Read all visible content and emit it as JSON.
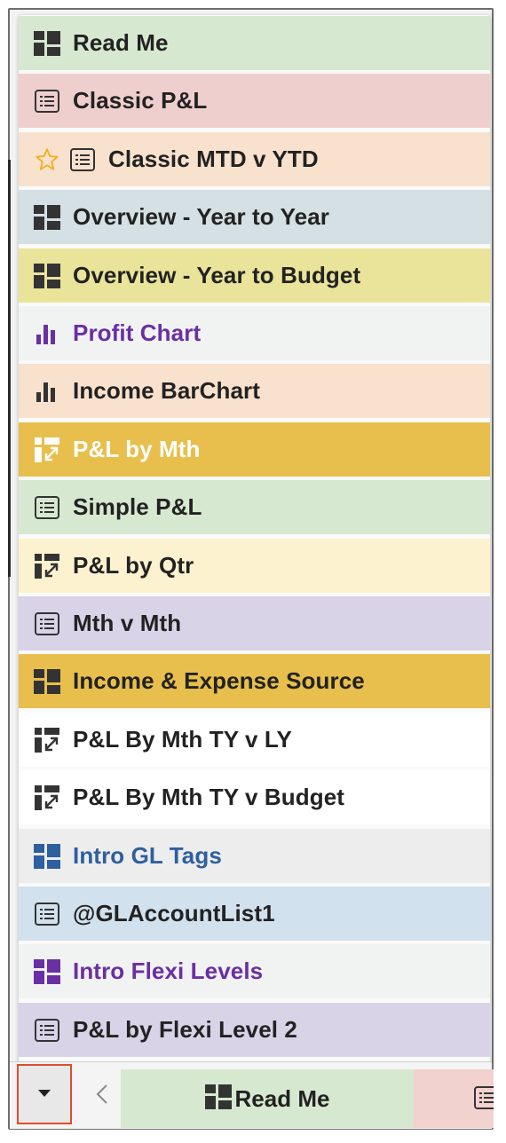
{
  "menu": {
    "items": [
      {
        "label": "Read Me",
        "icon": "dashboard-icon",
        "bg": "#d7e8d0",
        "fg": "#222222",
        "icon_color": "#333333",
        "favorite": false
      },
      {
        "label": "Classic P&L",
        "icon": "report-list-icon",
        "bg": "#efcfcd",
        "fg": "#222222",
        "icon_color": "#333333",
        "favorite": false
      },
      {
        "label": "Classic MTD v YTD",
        "icon": "report-list-icon",
        "bg": "#f8e1cd",
        "fg": "#222222",
        "icon_color": "#333333",
        "favorite": true,
        "favorite_icon": "star-icon"
      },
      {
        "label": "Overview - Year to Year",
        "icon": "dashboard-icon",
        "bg": "#d4e0e3",
        "fg": "#222222",
        "icon_color": "#333333",
        "favorite": false
      },
      {
        "label": "Overview - Year to Budget",
        "icon": "dashboard-icon",
        "bg": "#eae49a",
        "fg": "#222222",
        "icon_color": "#333333",
        "favorite": false
      },
      {
        "label": "Profit Chart",
        "icon": "bar-chart-icon",
        "bg": "#f1f2f2",
        "fg": "#6a2fa3",
        "icon_color": "#6a2fa3",
        "favorite": false
      },
      {
        "label": "Income BarChart",
        "icon": "bar-chart-icon",
        "bg": "#f8e1cd",
        "fg": "#222222",
        "icon_color": "#333333",
        "favorite": false
      },
      {
        "label": "P&L by Mth",
        "icon": "pivot-icon",
        "bg": "#e8bf4c",
        "fg": "#ffffff",
        "icon_color": "#ffffff",
        "favorite": false
      },
      {
        "label": "Simple P&L",
        "icon": "report-list-icon",
        "bg": "#d7e8d0",
        "fg": "#222222",
        "icon_color": "#333333",
        "favorite": false
      },
      {
        "label": "P&L by Qtr",
        "icon": "pivot-icon",
        "bg": "#fdf2cf",
        "fg": "#222222",
        "icon_color": "#333333",
        "favorite": false
      },
      {
        "label": "Mth v Mth",
        "icon": "report-list-icon",
        "bg": "#d9d3e8",
        "fg": "#222222",
        "icon_color": "#333333",
        "favorite": false
      },
      {
        "label": "Income & Expense Source",
        "icon": "dashboard-icon",
        "bg": "#e8bf4c",
        "fg": "#222222",
        "icon_color": "#333333",
        "favorite": false
      },
      {
        "label": "P&L By Mth TY v LY",
        "icon": "pivot-icon",
        "bg": "#ffffff",
        "fg": "#222222",
        "icon_color": "#333333",
        "favorite": false
      },
      {
        "label": "P&L By Mth TY v Budget",
        "icon": "pivot-icon",
        "bg": "#ffffff",
        "fg": "#222222",
        "icon_color": "#333333",
        "favorite": false
      },
      {
        "label": "Intro GL Tags",
        "icon": "dashboard-icon",
        "bg": "#ededed",
        "fg": "#2e5f9e",
        "icon_color": "#2e5f9e",
        "favorite": false
      },
      {
        "label": "@GLAccountList1",
        "icon": "report-list-icon",
        "bg": "#d2e1ee",
        "fg": "#222222",
        "icon_color": "#333333",
        "favorite": false
      },
      {
        "label": "Intro Flexi Levels",
        "icon": "dashboard-icon",
        "bg": "#f1f2f2",
        "fg": "#6a2fa3",
        "icon_color": "#6a2fa3",
        "favorite": false
      },
      {
        "label": "P&L by Flexi Level 2",
        "icon": "report-list-icon",
        "bg": "#d9d3e8",
        "fg": "#222222",
        "icon_color": "#333333",
        "favorite": false
      }
    ]
  },
  "tabbar": {
    "dropdown_icon": "caret-down-icon",
    "prev_icon": "chevron-left-icon",
    "active_tab": {
      "label": "Read Me",
      "icon": "dashboard-icon",
      "bg": "#d7e8d0"
    },
    "next_tab": {
      "icon": "report-list-icon",
      "bg": "#f1d2cf"
    }
  }
}
